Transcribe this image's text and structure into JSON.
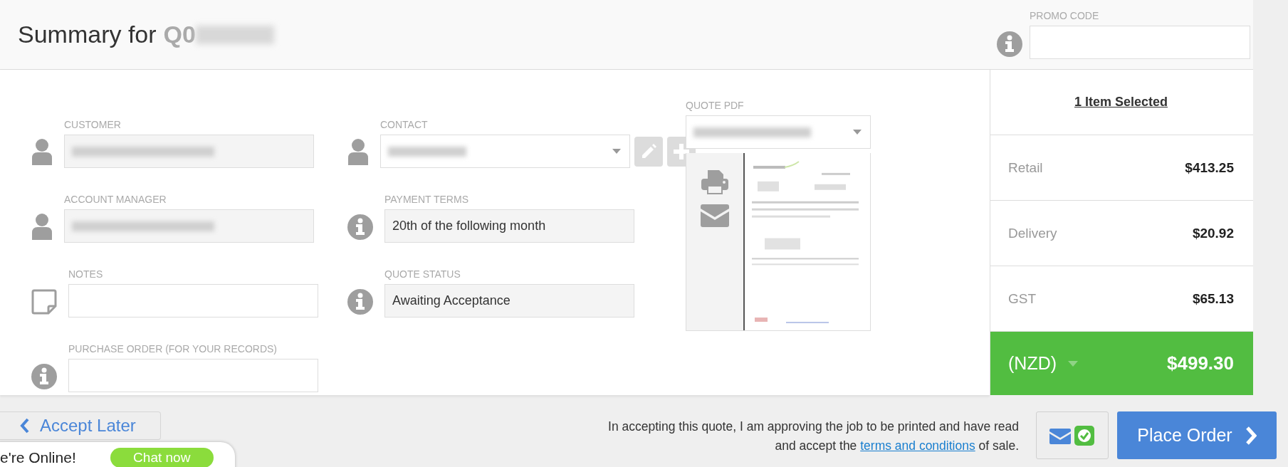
{
  "header": {
    "title": "Summary for",
    "quote_number": "Q0",
    "quote_number_redacted": true,
    "promo": {
      "label": "PROMO CODE"
    }
  },
  "left_fields": [
    {
      "label": "CUSTOMER",
      "kind": "readonly",
      "redacted": true
    },
    {
      "label": "ACCOUNT MANAGER",
      "kind": "readonly",
      "redacted": true
    },
    {
      "label": "NOTES",
      "kind": "input"
    },
    {
      "label": "PURCHASE ORDER (FOR YOUR RECORDS)",
      "kind": "input"
    }
  ],
  "middle_fields": [
    {
      "label": "CONTACT",
      "kind": "select",
      "redacted": true
    },
    {
      "label": "PAYMENT TERMS",
      "kind": "readonly",
      "value": "20th of the following month"
    },
    {
      "label": "QUOTE STATUS",
      "kind": "readonly",
      "value": "Awaiting Acceptance"
    }
  ],
  "quote_pdf": {
    "label": "QUOTE PDF",
    "redacted": true
  },
  "summary": {
    "heading": "1 Item Selected",
    "lines": [
      {
        "label": "Retail",
        "amount": "$413.25"
      },
      {
        "label": "Delivery",
        "amount": "$20.92"
      },
      {
        "label": "GST",
        "amount": "$65.13"
      }
    ],
    "total": {
      "currency": "(NZD)",
      "amount": "$499.30"
    }
  },
  "footer": {
    "back_button": "Accept Later",
    "terms": {
      "before": "In accepting this quote, I am approving the job to be printed and have read and accept the",
      "link": "terms and conditions",
      "after": "of sale."
    },
    "place_order": "Place Order"
  },
  "chat": {
    "status": "e're Online!",
    "button": "Chat now"
  }
}
